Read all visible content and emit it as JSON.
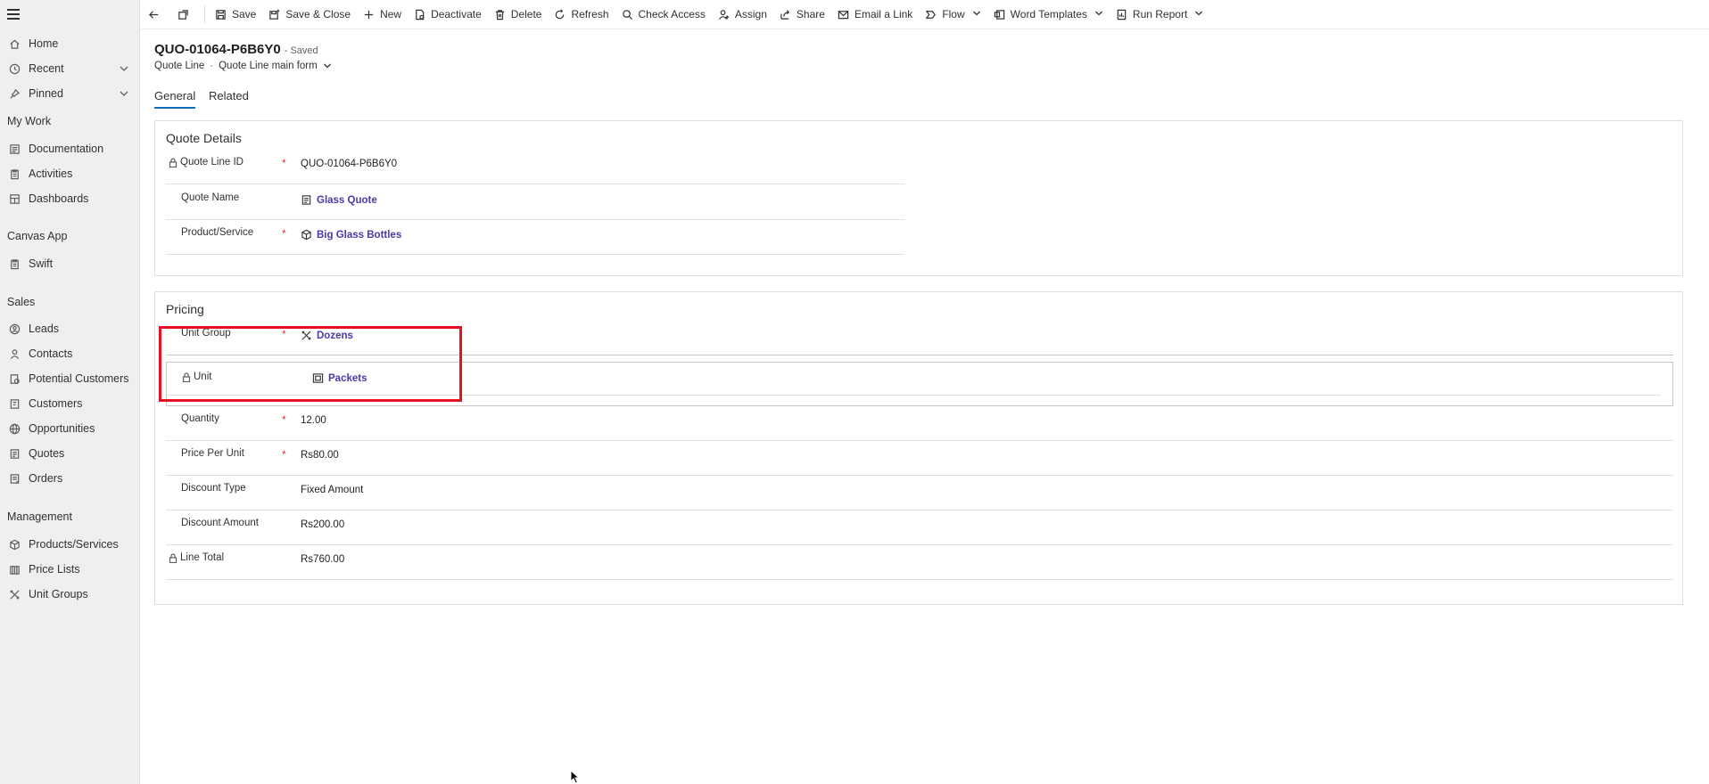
{
  "sidebar": {
    "top_items": [
      {
        "label": "Home",
        "icon": "home-icon"
      },
      {
        "label": "Recent",
        "icon": "clock-icon"
      },
      {
        "label": "Pinned",
        "icon": "pin-icon"
      }
    ],
    "groups": [
      {
        "title": "My Work",
        "items": [
          {
            "label": "Documentation",
            "icon": "document-icon"
          },
          {
            "label": "Activities",
            "icon": "clipboard-icon"
          },
          {
            "label": "Dashboards",
            "icon": "dashboard-icon"
          }
        ]
      },
      {
        "title": "Canvas App",
        "items": [
          {
            "label": "Swift",
            "icon": "clipboard-icon"
          }
        ]
      },
      {
        "title": "Sales",
        "items": [
          {
            "label": "Leads",
            "icon": "lead-icon"
          },
          {
            "label": "Contacts",
            "icon": "person-icon"
          },
          {
            "label": "Potential Customers",
            "icon": "potential-customer-icon"
          },
          {
            "label": "Customers",
            "icon": "customer-icon"
          },
          {
            "label": "Opportunities",
            "icon": "globe-icon"
          },
          {
            "label": "Quotes",
            "icon": "quote-icon"
          },
          {
            "label": "Orders",
            "icon": "order-icon"
          }
        ]
      },
      {
        "title": "Management",
        "items": [
          {
            "label": "Products/Services",
            "icon": "product-icon"
          },
          {
            "label": "Price Lists",
            "icon": "price-list-icon"
          },
          {
            "label": "Unit Groups",
            "icon": "unit-group-icon"
          }
        ]
      }
    ]
  },
  "commandbar": {
    "save": "Save",
    "save_close": "Save & Close",
    "new": "New",
    "deactivate": "Deactivate",
    "delete": "Delete",
    "refresh": "Refresh",
    "check_access": "Check Access",
    "assign": "Assign",
    "share": "Share",
    "email_link": "Email a Link",
    "flow": "Flow",
    "word_templates": "Word Templates",
    "run_report": "Run Report"
  },
  "header": {
    "title": "QUO-01064-P6B6Y0",
    "saved": "- Saved",
    "entity": "Quote Line",
    "form": "Quote Line main form"
  },
  "tabs": {
    "general": "General",
    "related": "Related"
  },
  "quote_details": {
    "title": "Quote Details",
    "quote_line_id_label": "Quote Line ID",
    "quote_line_id_value": "QUO-01064-P6B6Y0",
    "quote_name_label": "Quote Name",
    "quote_name_value": "Glass Quote",
    "product_label": "Product/Service",
    "product_value": "Big Glass Bottles"
  },
  "pricing": {
    "title": "Pricing",
    "unit_group_label": "Unit Group",
    "unit_group_value": "Dozens",
    "unit_label": "Unit",
    "unit_value": "Packets",
    "quantity_label": "Quantity",
    "quantity_value": "12.00",
    "price_per_unit_label": "Price Per Unit",
    "price_per_unit_value": "Rs80.00",
    "discount_type_label": "Discount Type",
    "discount_type_value": "Fixed Amount",
    "discount_amount_label": "Discount Amount",
    "discount_amount_value": "Rs200.00",
    "line_total_label": "Line Total",
    "line_total_value": "Rs760.00"
  },
  "required_marker": "*",
  "colors": {
    "accent": "#0f6cbd",
    "link": "#4a3aa7",
    "required": "#d13438",
    "highlight": "#e81123"
  }
}
